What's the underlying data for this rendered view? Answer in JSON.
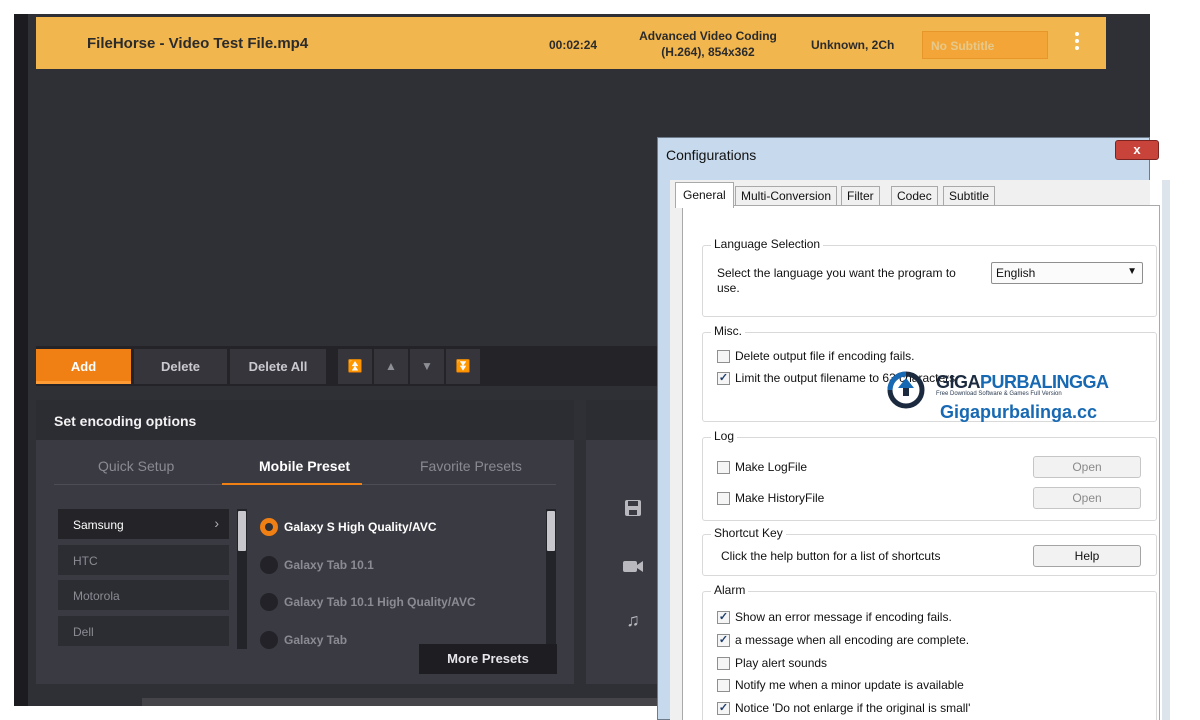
{
  "file": {
    "name": "FileHorse - Video Test File.mp4",
    "duration": "00:02:24",
    "codec_line1": "Advanced Video Coding",
    "codec_line2": "(H.264), 854x362",
    "audio": "Unknown, 2Ch",
    "subtitle": "No Subtitle"
  },
  "toolbar": {
    "add": "Add",
    "delete": "Delete",
    "delete_all": "Delete All"
  },
  "encoding": {
    "title": "Set encoding options",
    "tabs": [
      "Quick Setup",
      "Mobile Preset",
      "Favorite Presets"
    ],
    "brands": [
      "Samsung",
      "HTC",
      "Motorola",
      "Dell"
    ],
    "presets": [
      "Galaxy S High Quality/AVC",
      "Galaxy Tab 10.1",
      "Galaxy Tab 10.1 High Quality/AVC",
      "Galaxy Tab"
    ],
    "more_presets": "More Presets"
  },
  "dialog": {
    "title": "Configurations",
    "close": "x",
    "tabs": [
      "General",
      "Multi-Conversion",
      "Filter",
      "Codec",
      "Subtitle"
    ],
    "language": {
      "label": "Language Selection",
      "prompt_line1": "Select the language you want the program to",
      "prompt_line2": "use.",
      "selected": "English"
    },
    "misc": {
      "label": "Misc.",
      "options": [
        {
          "text": "Delete output file if encoding fails.",
          "checked": ""
        },
        {
          "text": "Limit the output filename to 63 characters",
          "checked": "✓"
        }
      ]
    },
    "log": {
      "label": "Log",
      "options": [
        {
          "text": "Make LogFile",
          "checked": "",
          "button": "Open"
        },
        {
          "text": "Make HistoryFile",
          "checked": "",
          "button": "Open"
        }
      ]
    },
    "shortcut": {
      "label": "Shortcut Key",
      "text": "Click the help button for a list of shortcuts",
      "button": "Help"
    },
    "alarm": {
      "label": "Alarm",
      "options": [
        {
          "text": "Show an error message if encoding fails.",
          "checked": "✓"
        },
        {
          "text": "a message when all encoding are complete.",
          "checked": "✓"
        },
        {
          "text": "Play alert sounds",
          "checked": ""
        },
        {
          "text": "Notify me when a minor update is available",
          "checked": ""
        },
        {
          "text": "Notice 'Do not enlarge if the original is small'",
          "checked": "✓"
        }
      ]
    }
  },
  "watermark": {
    "brand_part1": "GIGA",
    "brand_part2": "PURBALINGGA",
    "tagline": "Free Download Software & Games Full Version",
    "site": "Gigapurbalinga.cc"
  },
  "colors": {
    "accent": "#f07f14",
    "file_row": "#f1b64e",
    "dialog_frame": "#c7d9ec"
  }
}
